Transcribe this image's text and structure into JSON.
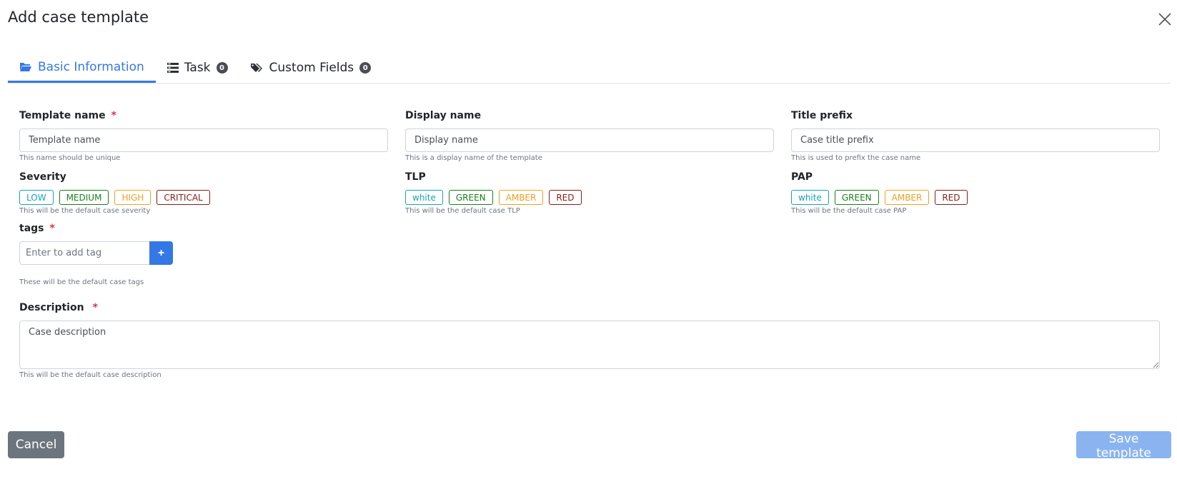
{
  "modal": {
    "title": "Add case template",
    "close_icon": "close-icon"
  },
  "tabs": [
    {
      "label": "Basic Information",
      "icon": "folder-open-icon",
      "active": true
    },
    {
      "label": "Task",
      "icon": "tasks-icon",
      "badge": "0"
    },
    {
      "label": "Custom Fields",
      "icon": "tags-icon",
      "badge": "0"
    }
  ],
  "form": {
    "template_name": {
      "label": "Template name",
      "required": "*",
      "placeholder": "Template name",
      "hint": "This name should be unique"
    },
    "display_name": {
      "label": "Display name",
      "placeholder": "Display name",
      "hint": "This is a display name of the template"
    },
    "title_prefix": {
      "label": "Title prefix",
      "placeholder": "Case title prefix",
      "hint": "This is used to prefix the case name"
    },
    "severity": {
      "label": "Severity",
      "options": [
        "LOW",
        "MEDIUM",
        "HIGH",
        "CRITICAL"
      ],
      "hint": "This will be the default case severity"
    },
    "tlp": {
      "label": "TLP",
      "options": [
        "white",
        "GREEN",
        "AMBER",
        "RED"
      ],
      "hint": "This will be the default case TLP"
    },
    "pap": {
      "label": "PAP",
      "options": [
        "white",
        "GREEN",
        "AMBER",
        "RED"
      ],
      "hint": "This will be the default case PAP"
    },
    "tags": {
      "label": "tags",
      "required": "*",
      "placeholder": "Enter to add tag",
      "add_label": "+",
      "hint": "These will be the default case tags"
    },
    "description": {
      "label": "Description",
      "required": "*",
      "placeholder": "Case description",
      "hint": "This will be the default case description"
    }
  },
  "footer": {
    "cancel_label": "Cancel",
    "save_label": "Save template"
  },
  "colors": {
    "accent": "#3478e5",
    "low": "#17a2b8",
    "green": "#1a7f1a",
    "amber": "#f0a020",
    "red": "#8b1a1a",
    "required": "#dc3545"
  }
}
